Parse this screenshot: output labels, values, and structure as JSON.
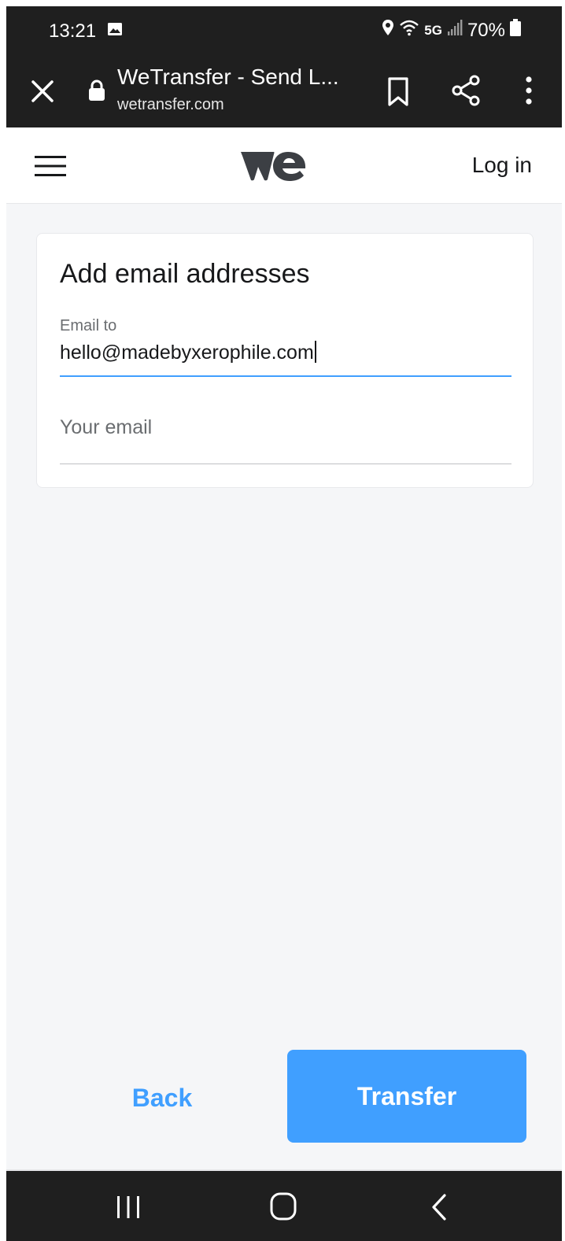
{
  "status_bar": {
    "time": "13:21",
    "network": "5G",
    "battery": "70%",
    "icons": [
      "gallery-icon",
      "location-icon",
      "wifi-icon",
      "signal-icon",
      "battery-icon"
    ]
  },
  "browser": {
    "title": "WeTransfer - Send L...",
    "url": "wetransfer.com",
    "icons": [
      "close-icon",
      "lock-icon",
      "bookmark-icon",
      "share-icon",
      "more-vert-icon"
    ]
  },
  "site_header": {
    "login_label": "Log in",
    "icons": [
      "hamburger-menu-icon",
      "wetransfer-logo"
    ]
  },
  "form": {
    "title": "Add email addresses",
    "email_to_label": "Email to",
    "email_to_value": "hello@madebyxerophile.com",
    "your_email_placeholder": "Your email"
  },
  "actions": {
    "back_label": "Back",
    "transfer_label": "Transfer"
  },
  "nav_bar": {
    "icons": [
      "recents-icon",
      "home-icon",
      "back-icon"
    ]
  },
  "colors": {
    "accent": "#409fff",
    "system_bar": "#1f1f1f",
    "page_bg": "#f5f6f8",
    "text": "#17181a"
  }
}
